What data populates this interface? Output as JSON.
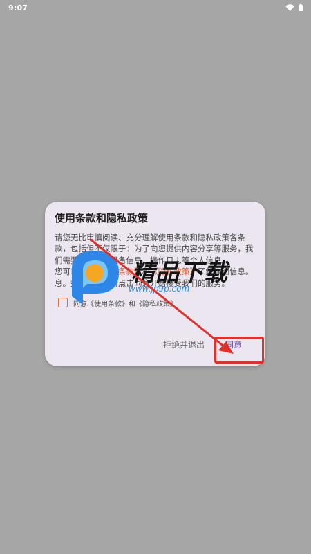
{
  "status_bar": {
    "time": "9:07",
    "icons": [
      "wifi-icon",
      "battery-icon"
    ]
  },
  "dialog": {
    "title": "使用条款和隐私政策",
    "body_line_1": "请您无比审慎阅读、充分理解使用条款和隐私政策各条",
    "body_line_2": "款，包括但不仅限于：为了向您提供内容分享等服务，我",
    "body_line_3": "们需要收集您的设备信息、操作日志等个人信息。",
    "body_line_4_prefix": "您可以阅读",
    "body_line_4_link_1": "《使用条款》",
    "body_line_4_mid": "和",
    "body_line_4_link_2": "《隐私政策》",
    "body_line_4_suffix": "了解详细信息。",
    "body_line_5": "息。如您同意，请点击同意开始接受我们的服务。",
    "agree_prefix": "同意",
    "agree_terms": "《使用条款》",
    "agree_and": "和",
    "agree_privacy": "《隐私政策》",
    "reject_label": "拒绝并退出",
    "agree_label": "同意"
  },
  "watermark": {
    "brand": "精品下载",
    "url": "www.jp9p.com"
  },
  "colors": {
    "background": "#a6a6a6",
    "dialog": "#ece6f0",
    "accent": "#6b4ba8",
    "annotation": "#e0302a",
    "link": "#e0602c"
  }
}
